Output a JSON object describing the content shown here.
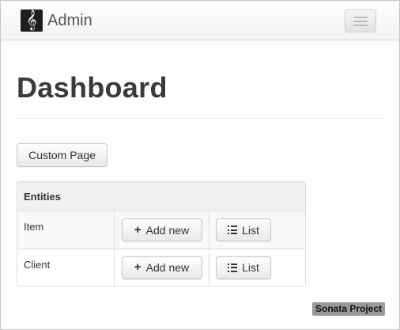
{
  "navbar": {
    "brand_text": "Admin",
    "logo_icon": "treble-clef-icon",
    "toggle_icon": "hamburger-menu-icon"
  },
  "page": {
    "title": "Dashboard"
  },
  "actions": {
    "custom_page_label": "Custom Page"
  },
  "entities_table": {
    "header": "Entities",
    "rows": [
      {
        "name": "Item",
        "add_label": "Add new",
        "list_label": "List"
      },
      {
        "name": "Client",
        "add_label": "Add new",
        "list_label": "List"
      }
    ],
    "add_icon": "plus-icon",
    "list_icon": "list-icon"
  },
  "footer": {
    "badge": "Sonata Project"
  },
  "colors": {
    "title": "#3a3a3a",
    "badge_bg": "#999999",
    "logo_bg": "#1e1e1e"
  }
}
